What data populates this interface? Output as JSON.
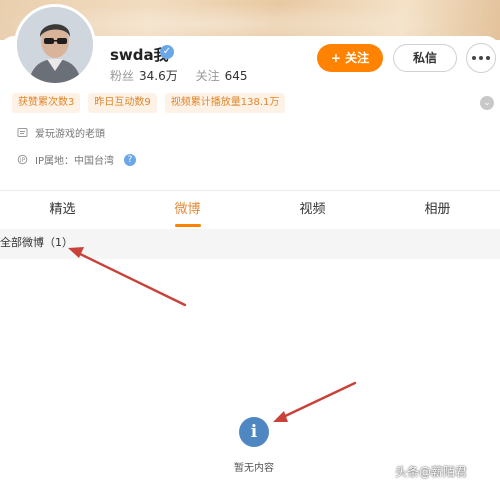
{
  "profile": {
    "username": "swda我",
    "verified_icon": "verified-check-icon",
    "fans_label": "粉丝",
    "fans_count": "34.6万",
    "following_label": "关注",
    "following_count": "645"
  },
  "actions": {
    "follow_label": "+ 关注",
    "message_label": "私信",
    "more_icon": "more-dots-icon"
  },
  "tags": [
    "获赞累次数3",
    "昨日互动数9",
    "视频累计播放量138.1万"
  ],
  "bio": "爱玩游戏的老頭",
  "ip": {
    "label": "IP属地：中国台湾"
  },
  "tabs": [
    {
      "label": "精选"
    },
    {
      "label": "微博",
      "active": true
    },
    {
      "label": "视频"
    },
    {
      "label": "相册"
    }
  ],
  "section": {
    "title": "全部微博（1）"
  },
  "empty": {
    "text": "暂无内容",
    "icon": "info-icon"
  },
  "watermark": "头条@薪陌君",
  "colors": {
    "accent": "#ff8200",
    "tag_bg": "#fdf2e5",
    "tag_text": "#e0862c",
    "info_icon": "#4e87c2",
    "annotation_arrow": "#c8423a"
  }
}
